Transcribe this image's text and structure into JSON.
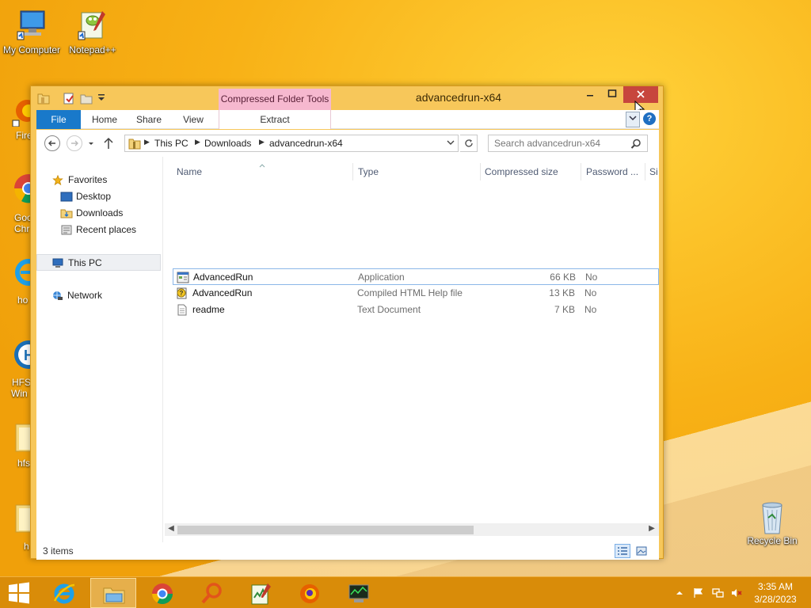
{
  "desktop": {
    "icons": [
      {
        "id": "my-computer",
        "label": "My Computer"
      },
      {
        "id": "notepadpp",
        "label": "Notepad++"
      },
      {
        "id": "recycle-bin",
        "label": "Recycle Bin"
      }
    ],
    "partial_labels": [
      "Fire",
      "Goo",
      "Chr",
      "ho",
      "HFS",
      "Win",
      "hfs",
      "h"
    ]
  },
  "window": {
    "title": "advancedrun-x64",
    "context_tab": "Compressed Folder Tools",
    "ribbon_tabs": [
      "File",
      "Home",
      "Share",
      "View",
      "Extract"
    ],
    "address": {
      "crumbs": [
        "This PC",
        "Downloads",
        "advancedrun-x64"
      ]
    },
    "search": {
      "placeholder": "Search advancedrun-x64"
    },
    "nav_pane": {
      "favorites": "Favorites",
      "items": [
        "Desktop",
        "Downloads",
        "Recent places"
      ],
      "this_pc": "This PC",
      "network": "Network"
    },
    "columns": [
      "Name",
      "Type",
      "Compressed size",
      "Password ...",
      "Si"
    ],
    "files": [
      {
        "name": "AdvancedRun",
        "type": "Application",
        "size": "66 KB",
        "password": "No",
        "icon": "application-icon"
      },
      {
        "name": "AdvancedRun",
        "type": "Compiled HTML Help file",
        "size": "13 KB",
        "password": "No",
        "icon": "chm-help-icon"
      },
      {
        "name": "readme",
        "type": "Text Document",
        "size": "7 KB",
        "password": "No",
        "icon": "text-document-icon"
      }
    ],
    "status": {
      "item_count": "3 items"
    }
  },
  "taskbar": {
    "apps": [
      "internet-explorer-icon",
      "file-explorer-icon",
      "chrome-icon",
      "search-tool-icon",
      "notepadpp-icon",
      "firefox-icon",
      "monitor-app-icon"
    ],
    "clock": {
      "time": "3:35 AM",
      "date": "3/28/2023"
    }
  },
  "colors": {
    "accent": "#1979ca",
    "close": "#c7463d",
    "context_tab": "#f6b8cf",
    "window_frame": "#f7c75a"
  }
}
